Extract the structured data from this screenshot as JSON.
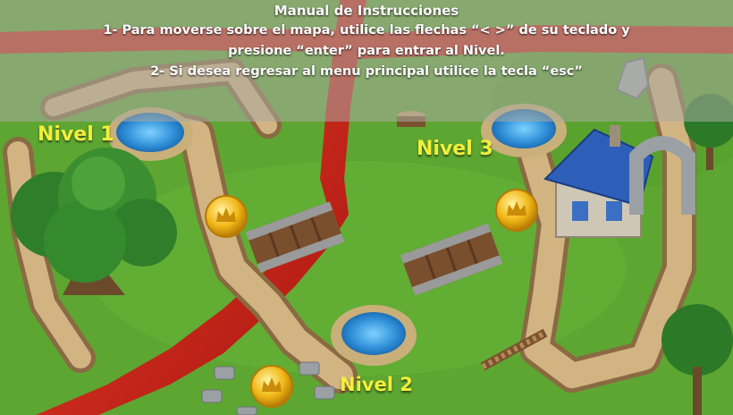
{
  "instructions": {
    "title": "Manual de Instrucciones",
    "line1": "1- Para moverse sobre el mapa, utilice las flechas “< >” de su teclado y",
    "line2": "presione “enter” para entrar al Nivel.",
    "line3": "2- Si desea regresar al menu principal utilice la tecla “esc”"
  },
  "levels": [
    {
      "label": "Nivel 1"
    },
    {
      "label": "Nivel 2"
    },
    {
      "label": "Nivel 3"
    }
  ],
  "colors": {
    "grass": "#5da631",
    "lava": "#d2241b",
    "path": "#d2b483",
    "water": "#3d9be0",
    "label": "#f2ef3a",
    "roof": "#2e5fb8",
    "coin": "#f1b817"
  },
  "icons": [
    "tree-icon",
    "bridge-icon",
    "coin-crown-icon",
    "house-icon",
    "stone-arch-icon",
    "rock-icon",
    "stump-icon"
  ]
}
